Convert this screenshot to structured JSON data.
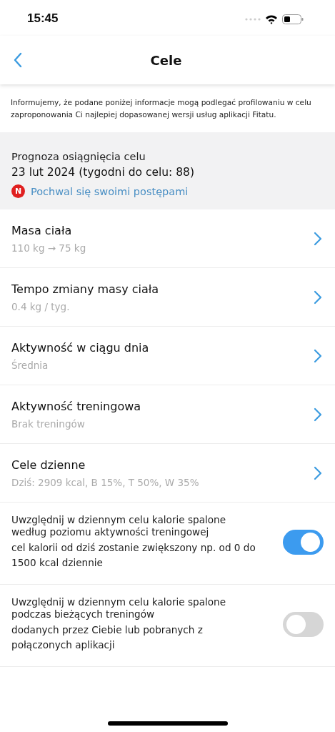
{
  "status_bar": {
    "time": "15:45"
  },
  "nav": {
    "title": "Cele"
  },
  "notice": "Informujemy, że podane poniżej informacje mogą podlegać profilowaniu w celu zaproponowania Ci najlepiej dopasowanej wersji usług aplikacji Fitatu.",
  "forecast": {
    "label": "Prognoza osiągnięcia celu",
    "date": "23 lut 2024 (tygodni do celu: 88)",
    "badge": "N",
    "share_link": "Pochwal się swoimi postępami"
  },
  "settings": [
    {
      "title": "Masa ciała",
      "value": "110 kg → 75 kg"
    },
    {
      "title": "Tempo zmiany masy ciała",
      "value": "0.4 kg / tyg."
    },
    {
      "title": "Aktywność w ciągu dnia",
      "value": "Średnia"
    },
    {
      "title": "Aktywność treningowa",
      "value": "Brak treningów"
    },
    {
      "title": "Cele dzienne",
      "value": "Dziś: 2909 kcal, B 15%, T 50%, W 35%"
    }
  ],
  "toggles": [
    {
      "title": "Uwzględnij w dziennym celu kalorie spalone według poziomu aktywności treningowej",
      "description": "cel kalorii od dziś zostanie zwiększony np. od 0 do 1500 kcal dziennie",
      "on": true
    },
    {
      "title": "Uwzględnij w dziennym celu kalorie spalone podczas bieżących treningów",
      "description": "dodanych przez Ciebie lub pobranych z połączonych aplikacji",
      "on": false
    }
  ]
}
